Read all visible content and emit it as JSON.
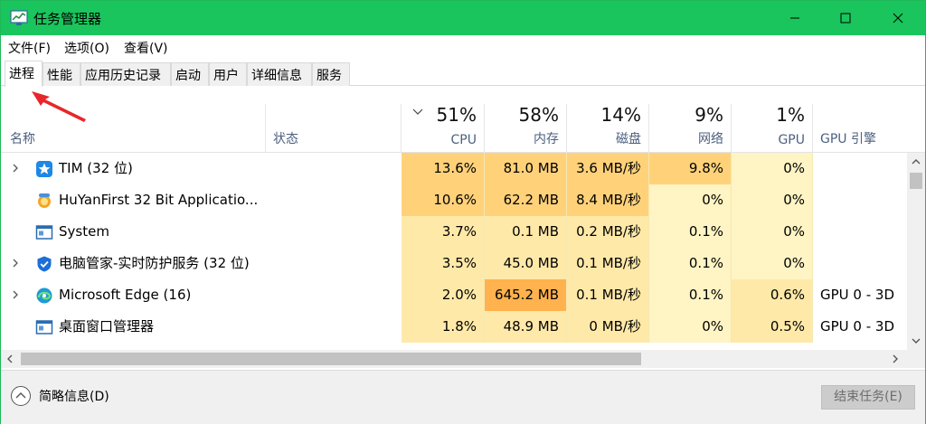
{
  "window": {
    "title": "任务管理器"
  },
  "menu": {
    "file": "文件(F)",
    "options": "选项(O)",
    "view": "查看(V)"
  },
  "tabs": [
    {
      "label": "进程",
      "active": true
    },
    {
      "label": "性能",
      "active": false
    },
    {
      "label": "应用历史记录",
      "active": false
    },
    {
      "label": "启动",
      "active": false
    },
    {
      "label": "用户",
      "active": false
    },
    {
      "label": "详细信息",
      "active": false
    },
    {
      "label": "服务",
      "active": false
    }
  ],
  "columns": {
    "name": "名称",
    "status": "状态",
    "cpu": {
      "label": "CPU",
      "total": "51%"
    },
    "memory": {
      "label": "内存",
      "total": "58%"
    },
    "disk": {
      "label": "磁盘",
      "total": "14%"
    },
    "network": {
      "label": "网络",
      "total": "9%"
    },
    "gpu": {
      "label": "GPU",
      "total": "1%"
    },
    "gpu_engine": "GPU 引擎"
  },
  "processes": [
    {
      "name": "TIM (32 位)",
      "icon": "tim-star-icon",
      "expandable": true,
      "cpu": "13.6%",
      "memory": "81.0 MB",
      "disk": "3.6 MB/秒",
      "network": "9.8%",
      "gpu": "0%",
      "gpu_engine": ""
    },
    {
      "name": "HuYanFirst 32 Bit Applicatio...",
      "icon": "huyan-app-icon",
      "expandable": false,
      "cpu": "10.6%",
      "memory": "62.2 MB",
      "disk": "8.4 MB/秒",
      "network": "0%",
      "gpu": "0%",
      "gpu_engine": ""
    },
    {
      "name": "System",
      "icon": "system-window-icon",
      "expandable": false,
      "cpu": "3.7%",
      "memory": "0.1 MB",
      "disk": "0.2 MB/秒",
      "network": "0.1%",
      "gpu": "0%",
      "gpu_engine": ""
    },
    {
      "name": "电脑管家-实时防护服务 (32 位)",
      "icon": "shield-icon",
      "expandable": true,
      "cpu": "3.5%",
      "memory": "45.0 MB",
      "disk": "0.1 MB/秒",
      "network": "0.1%",
      "gpu": "0%",
      "gpu_engine": ""
    },
    {
      "name": "Microsoft Edge (16)",
      "icon": "edge-browser-icon",
      "expandable": true,
      "cpu": "2.0%",
      "memory": "645.2 MB",
      "disk": "0.1 MB/秒",
      "network": "0.1%",
      "gpu": "0.6%",
      "gpu_engine": "GPU 0 - 3D"
    },
    {
      "name": "桌面窗口管理器",
      "icon": "system-window-icon",
      "expandable": false,
      "cpu": "1.8%",
      "memory": "48.9 MB",
      "disk": "0 MB/秒",
      "network": "0%",
      "gpu": "0.5%",
      "gpu_engine": "GPU 0 - 3D"
    }
  ],
  "heat_colors": {
    "low": "#fff4c4",
    "mid": "#ffe9a8",
    "high": "#ffd27a",
    "extreme": "#ffb24d"
  },
  "footer": {
    "less_details": "简略信息(D)",
    "end_task": "结束任务(E)"
  }
}
